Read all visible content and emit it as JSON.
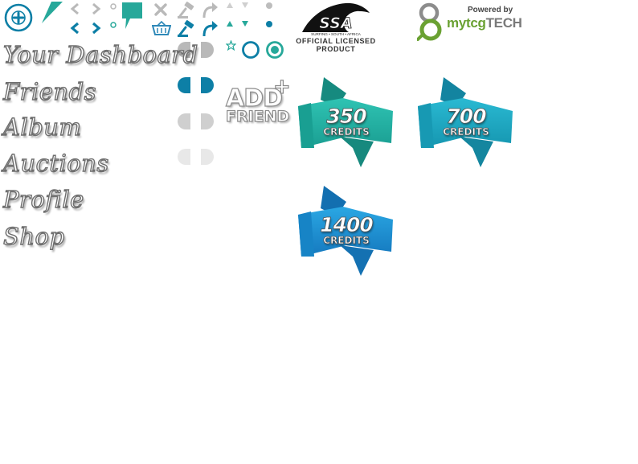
{
  "colors": {
    "teal": "#27a89a",
    "blue": "#0d7fa6",
    "grey": "#b9b9b9",
    "light_grey": "#e3e3e3",
    "dark_outline": "#6e6e6e"
  },
  "menu": {
    "items": [
      {
        "label": "Your Dashboard"
      },
      {
        "label": "Friends"
      },
      {
        "label": "Album"
      },
      {
        "label": "Auctions"
      },
      {
        "label": "Profile"
      },
      {
        "label": "Shop"
      }
    ]
  },
  "icons": {
    "add": "plus-circle-icon",
    "corner": "corner-triangle-icon",
    "arrows": "chevron-icons",
    "speech": "speech-bubble-icon",
    "close": "close-icon",
    "basket": "basket-icon",
    "gavel": "gavel-icon",
    "redo": "redo-arrow-icon",
    "triangles": "triangle-icons",
    "dots": "dot-icons",
    "star": "star-icon",
    "rings": "ring-icons",
    "toggles": "toggle-pill-icons"
  },
  "add_friend": {
    "line1": "ADD",
    "line2": "FRIEND",
    "plus": "+"
  },
  "ssa": {
    "mark": "SSA",
    "tagline": "SURFING • SOUTH • AFRICA",
    "line1": "OFFICIAL LICENSED",
    "line2": "PRODUCT"
  },
  "powered": {
    "prefix": "Powered by",
    "brand_a": "mytcg",
    "brand_b": "TECH"
  },
  "credits": [
    {
      "amount": "350",
      "unit": "CREDITS",
      "color_top": "#2fc3b3",
      "color_bottom": "#1a9e92"
    },
    {
      "amount": "700",
      "unit": "CREDITS",
      "color_top": "#2ab9d2",
      "color_bottom": "#1596b0"
    },
    {
      "amount": "1400",
      "unit": "CREDITS",
      "color_top": "#2aa7e3",
      "color_bottom": "#1579bf"
    }
  ]
}
